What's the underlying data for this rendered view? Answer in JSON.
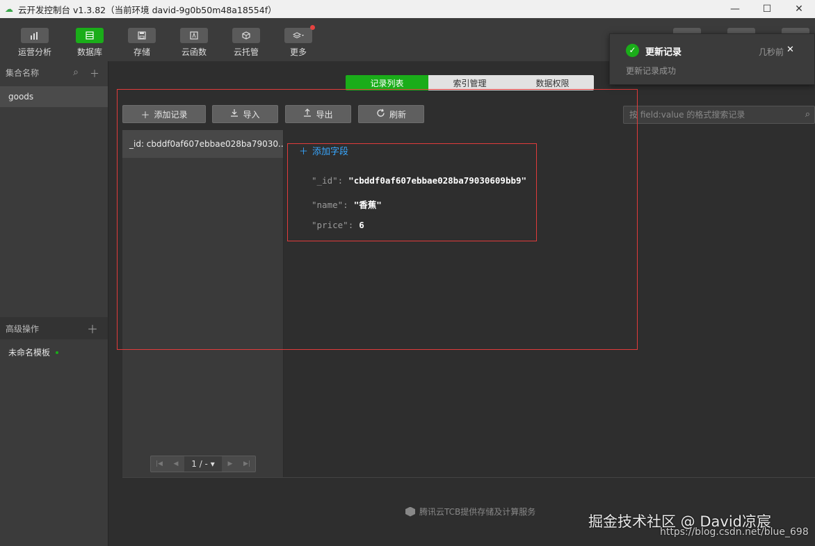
{
  "window": {
    "app_icon": "cloud-icon",
    "title": "云开发控制台 v1.3.82（当前环境 david-9g0b50m48a18554f）",
    "minimize": "—",
    "maximize": "☐",
    "close": "✕"
  },
  "toolbar": {
    "items": [
      {
        "label": "运营分析",
        "icon": "bar-chart-icon"
      },
      {
        "label": "数据库",
        "icon": "database-icon",
        "active": true
      },
      {
        "label": "存储",
        "icon": "save-icon"
      },
      {
        "label": "云函数",
        "icon": "function-icon"
      },
      {
        "label": "云托管",
        "icon": "box-icon"
      },
      {
        "label": "更多",
        "icon": "layers-icon"
      }
    ]
  },
  "sidebar": {
    "collections_header": "集合名称",
    "collections": [
      "goods"
    ],
    "advanced_header": "高级操作",
    "templates": [
      "未命名模板"
    ]
  },
  "tabs": [
    "记录列表",
    "索引管理",
    "数据权限"
  ],
  "actions": {
    "add": "添加记录",
    "import": "导入",
    "export": "导出",
    "refresh": "刷新"
  },
  "search": {
    "placeholder": "按 field:value 的格式搜索记录"
  },
  "records": [
    "_id: cbddf0af607ebbae028ba79030..."
  ],
  "detail": {
    "add_field": "添加字段",
    "fields": [
      {
        "key": "\"_id\"",
        "value": "\"cbddf0af607ebbae028ba79030609bb9\""
      },
      {
        "key": "\"name\"",
        "value": "\"香蕉\""
      },
      {
        "key": "\"price\"",
        "value": "6"
      }
    ]
  },
  "pagination": {
    "page": "1 / -"
  },
  "toast": {
    "title": "更新记录",
    "time": "几秒前",
    "message": "更新记录成功"
  },
  "footer": {
    "text": "腾讯云TCB提供存储及计算服务"
  },
  "watermark": {
    "line1": "掘金技术社区 @ David凉宸",
    "line2": "https://blog.csdn.net/blue_698"
  },
  "colors": {
    "accent_green": "#1aad19",
    "link_blue": "#38a7ff",
    "annotation_red": "#e23b3b"
  }
}
